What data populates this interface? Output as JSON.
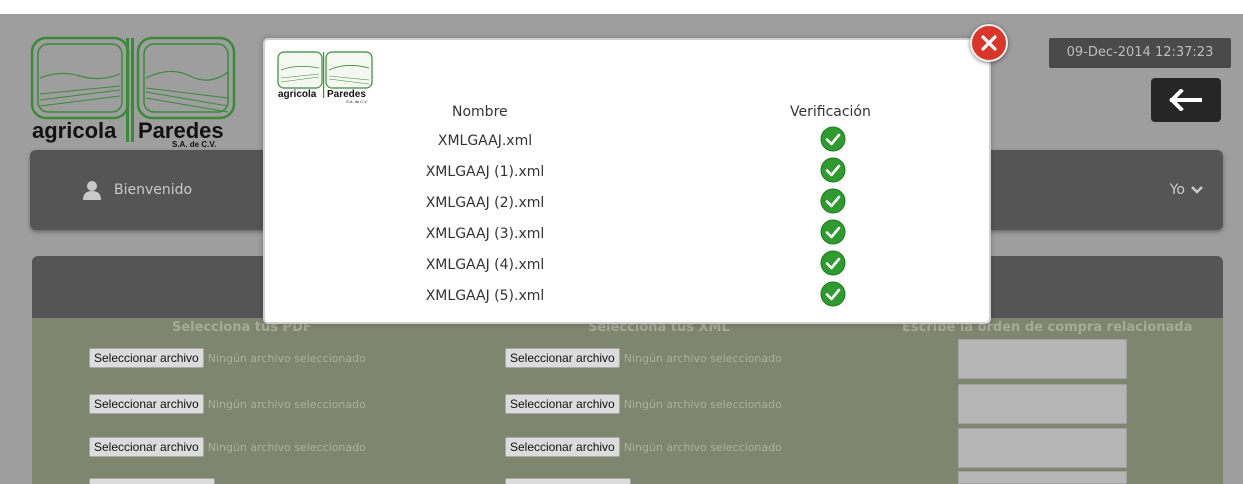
{
  "header": {
    "brand_text": "agricola Paredes",
    "brand_sub": "S.A. de C.V.",
    "datetime": "09-Dec-2014 12:37:23"
  },
  "nav": {
    "welcome": "Bienvenido",
    "user_menu": "Yo"
  },
  "upload": {
    "pdf_title": "Selecciona tus PDF",
    "xml_title": "Selecciona tus XML",
    "order_title": "Escribe la orden de compra relacionada",
    "button_label": "Seleccionar archivo",
    "none_label": "Ningún archivo seleccionado"
  },
  "modal": {
    "col_name": "Nombre",
    "col_verification": "Verificación",
    "files": [
      {
        "name": "XMLGAAJ.xml",
        "verified": true
      },
      {
        "name": "XMLGAAJ (1).xml",
        "verified": true
      },
      {
        "name": "XMLGAAJ (2).xml",
        "verified": true
      },
      {
        "name": "XMLGAAJ (3).xml",
        "verified": true
      },
      {
        "name": "XMLGAAJ (4).xml",
        "verified": true
      },
      {
        "name": "XMLGAAJ (5).xml",
        "verified": true
      }
    ]
  },
  "colors": {
    "accent_green": "#3a8a3a",
    "check_green": "#2f9a2f",
    "close_red": "#d9362b",
    "panel_green": "#7e8670"
  },
  "icons": {
    "user": "user-icon",
    "chevron": "chevron-down-icon",
    "back": "arrow-left-icon",
    "close": "close-icon",
    "check": "check-circle-icon"
  }
}
